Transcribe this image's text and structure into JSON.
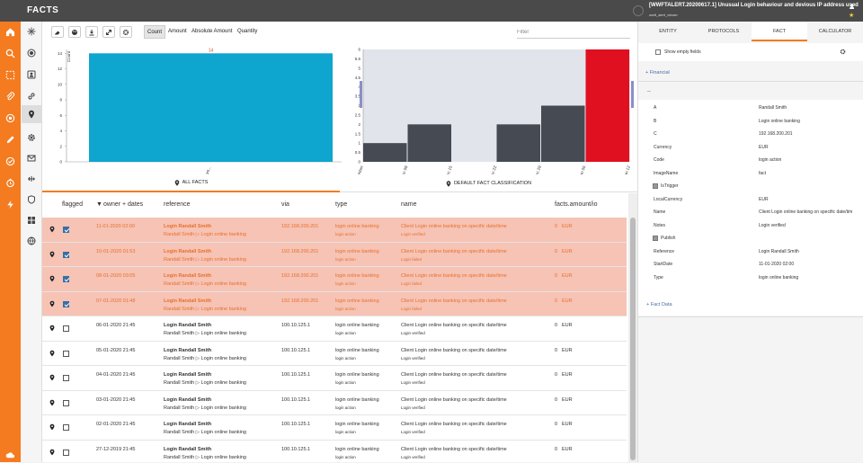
{
  "app": {
    "title": "FACTS",
    "alert_title": "[WWFTALERT.20200617.1] Unusual Login behaviour and devious IP address used",
    "alert_sub": "wwft_alert_viewer"
  },
  "toolbar": {
    "view_tabs": [
      "Count",
      "Amount",
      "Absolute Amount",
      "Quantity"
    ],
    "filter_placeholder": "Filter"
  },
  "chart_data": [
    {
      "type": "bar",
      "categories": [
        "login onl..."
      ],
      "values": [
        14
      ],
      "data_labels": [
        "14"
      ],
      "ylabel": "Count",
      "yticks": [
        0,
        2,
        4,
        6,
        8,
        10,
        12,
        14
      ],
      "ylim": [
        0,
        14.5
      ],
      "color": "#0ea5cf"
    },
    {
      "type": "bar",
      "x_ticks": [
        "December",
        "Dec 08",
        "Dec 15",
        "Dec 22",
        "Dec 29",
        "Jan 05",
        "Jan 12"
      ],
      "values": [
        1,
        2,
        0,
        2,
        3,
        6
      ],
      "yticks": [
        0,
        0.5,
        1,
        1.5,
        2,
        2.5,
        3,
        3.5,
        4,
        4.5,
        5,
        5.5,
        6
      ],
      "ylim": [
        0,
        6
      ],
      "colors": [
        "#454a53",
        "#454a53",
        "#454a53",
        "#454a53",
        "#454a53",
        "#e01020"
      ]
    }
  ],
  "panel_tabs": [
    "ALL FACTS",
    "DEFAULT FACT CLASSIFICATION"
  ],
  "table": {
    "headers": [
      "flagged",
      "owner + dates",
      "reference",
      "via",
      "type",
      "name",
      "facts.amount/io"
    ],
    "rows": [
      {
        "date": "11-01-2020 02:00",
        "ref1": "Login Randall Smith",
        "ref2": "Randall Smith ▷ Login online banking",
        "via": "192.168.200.201",
        "type1": "login online banking",
        "type2": "login action",
        "name1": "Client Login online banking on specific date/time",
        "name2": "Login verified",
        "amount": "0",
        "cur": "EUR",
        "flagged": true
      },
      {
        "date": "10-01-2020 01:53",
        "ref1": "Login Randall Smith",
        "ref2": "Randall Smith ▷ Login online banking",
        "via": "192.168.200.201",
        "type1": "login online banking",
        "type2": "login action",
        "name1": "Client Login online banking on specific date/time",
        "name2": "Login failed",
        "amount": "0",
        "cur": "EUR",
        "flagged": true
      },
      {
        "date": "08-01-2020 03:05",
        "ref1": "Login Randall Smith",
        "ref2": "Randall Smith ▷ Login online banking",
        "via": "192.168.200.201",
        "type1": "login online banking",
        "type2": "login action",
        "name1": "Client Login online banking on specific date/time",
        "name2": "Login failed",
        "amount": "0",
        "cur": "EUR",
        "flagged": true
      },
      {
        "date": "07-01-2020 01:48",
        "ref1": "Login Randall Smith",
        "ref2": "Randall Smith ▷ Login online banking",
        "via": "192.168.200.201",
        "type1": "login online banking",
        "type2": "login action",
        "name1": "Client Login online banking on specific date/time",
        "name2": "Login failed",
        "amount": "0",
        "cur": "EUR",
        "flagged": true
      },
      {
        "date": "06-01-2020 21:45",
        "ref1": "Login Randall Smith",
        "ref2": "Randall Smith ▷ Login online banking",
        "via": "100.10.125.1",
        "type1": "login online banking",
        "type2": "login action",
        "name1": "Client Login online banking on specific date/time",
        "name2": "Login verified",
        "amount": "0",
        "cur": "EUR",
        "flagged": false
      },
      {
        "date": "05-01-2020 21:45",
        "ref1": "Login Randall Smith",
        "ref2": "Randall Smith ▷ Login online banking",
        "via": "100.10.125.1",
        "type1": "login online banking",
        "type2": "login action",
        "name1": "Client Login online banking on specific date/time",
        "name2": "Login verified",
        "amount": "0",
        "cur": "EUR",
        "flagged": false
      },
      {
        "date": "04-01-2020 21:45",
        "ref1": "Login Randall Smith",
        "ref2": "Randall Smith ▷ Login online banking",
        "via": "100.10.125.1",
        "type1": "login online banking",
        "type2": "login action",
        "name1": "Client Login online banking on specific date/time",
        "name2": "Login verified",
        "amount": "0",
        "cur": "EUR",
        "flagged": false
      },
      {
        "date": "03-01-2020 21:45",
        "ref1": "Login Randall Smith",
        "ref2": "Randall Smith ▷ Login online banking",
        "via": "100.10.125.1",
        "type1": "login online banking",
        "type2": "login action",
        "name1": "Client Login online banking on specific date/time",
        "name2": "Login verified",
        "amount": "0",
        "cur": "EUR",
        "flagged": false
      },
      {
        "date": "02-01-2020 21:45",
        "ref1": "Login Randall Smith",
        "ref2": "Randall Smith ▷ Login online banking",
        "via": "100.10.125.1",
        "type1": "login online banking",
        "type2": "login action",
        "name1": "Client Login online banking on specific date/time",
        "name2": "Login verified",
        "amount": "0",
        "cur": "EUR",
        "flagged": false
      },
      {
        "date": "27-12-2019 21:45",
        "ref1": "Login Randall Smith",
        "ref2": "Randall Smith ▷ Login online banking",
        "via": "100.10.125.1",
        "type1": "login online banking",
        "type2": "login action",
        "name1": "Client Login online banking on specific date/time",
        "name2": "Login verified",
        "amount": "0",
        "cur": "EUR",
        "flagged": false
      }
    ]
  },
  "right_panel": {
    "tabs": [
      "ENTITY",
      "PROTOCOLS",
      "FACT",
      "CALCULATOR"
    ],
    "show_empty": "Show empty fields",
    "financial": "+ Financial",
    "dash": "--",
    "fields": [
      {
        "k": "A",
        "v": "Randall Smith"
      },
      {
        "k": "B",
        "v": "Login online banking"
      },
      {
        "k": "C",
        "v": "192.168.200.201"
      },
      {
        "k": "Currency",
        "v": "EUR"
      },
      {
        "k": "Code",
        "v": "login action"
      },
      {
        "k": "ImageName",
        "v": "fact"
      },
      {
        "k": "IsTrigger",
        "v": "",
        "check": true
      },
      {
        "k": "LocalCurrency",
        "v": "EUR"
      },
      {
        "k": "Name",
        "v": "Client Login online banking on specific date/tim"
      },
      {
        "k": "Notes",
        "v": "Login verified"
      },
      {
        "k": "Publish",
        "v": "",
        "check": true
      },
      {
        "k": "Reference",
        "v": "Login Randall Smith"
      },
      {
        "k": "StartDate",
        "v": "11-01-2020 02:00"
      },
      {
        "k": "Type",
        "v": "login online banking"
      }
    ],
    "fact_data": "+ Fact Data"
  }
}
